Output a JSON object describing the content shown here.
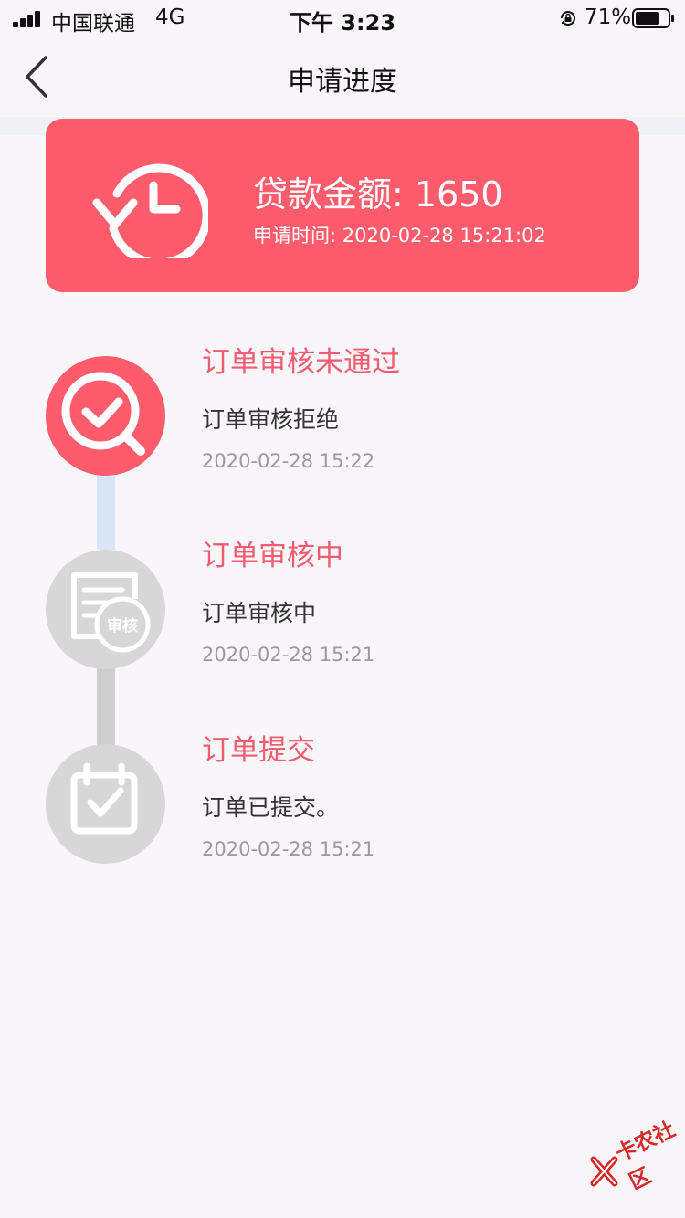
{
  "status_bar": {
    "carrier": "中国联通",
    "network": "4G",
    "time": "下午 3:23",
    "battery": "71%"
  },
  "header": {
    "title": "申请进度"
  },
  "loan_summary": {
    "amount_text": "贷款金额: 1650",
    "apply_time_text": "申请时间: 2020-02-28 15:21:02"
  },
  "steps": [
    {
      "title": "订单审核未通过",
      "description": "订单审核拒绝",
      "time": "2020-02-28 15:22",
      "icon": "search-check-icon"
    },
    {
      "title": "订单审核中",
      "description": "订单审核中",
      "time": "2020-02-28 15:21",
      "icon": "document-review-icon",
      "badge": "审核"
    },
    {
      "title": "订单提交",
      "description": "订单已提交。",
      "time": "2020-02-28 15:21",
      "icon": "calendar-check-icon"
    }
  ],
  "watermark": {
    "text": "卡农社区"
  },
  "colors": {
    "accent": "#fe5c6d",
    "step_title": "#f25c70",
    "inactive_circle": "#d7d7d7"
  }
}
